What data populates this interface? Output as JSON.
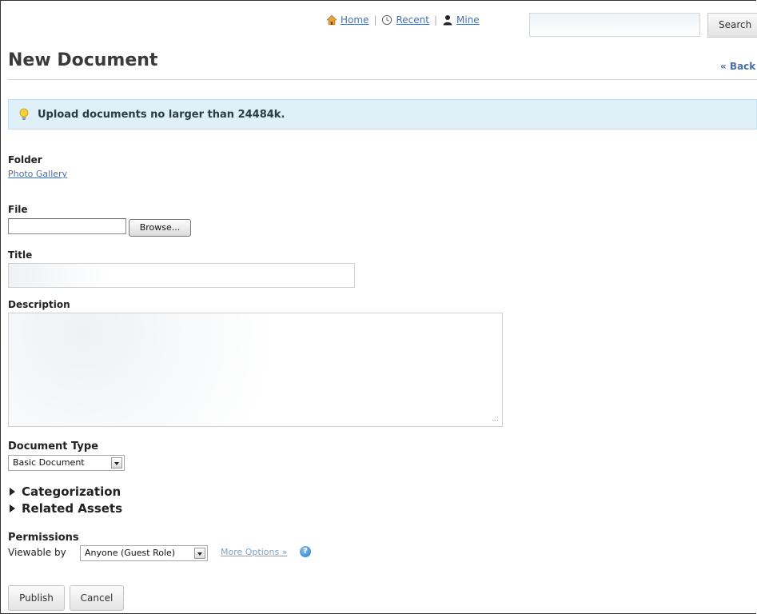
{
  "nav": {
    "home_label": "Home",
    "recent_label": "Recent",
    "mine_label": "Mine",
    "search_value": "",
    "search_button": "Search"
  },
  "page": {
    "title": "New Document",
    "back_label": "« Back"
  },
  "notice": {
    "text": "Upload documents no larger than 24484k."
  },
  "form": {
    "folder_label": "Folder",
    "folder_value": "Photo Gallery",
    "file_label": "File",
    "file_value": "",
    "browse_label": "Browse...",
    "title_label": "Title",
    "title_value": "",
    "description_label": "Description",
    "description_value": "",
    "doctype_label": "Document Type",
    "doctype_value": "Basic Document",
    "categorization_label": "Categorization",
    "related_assets_label": "Related Assets",
    "permissions_label": "Permissions",
    "viewable_by_label": "Viewable by",
    "viewable_by_value": "Anyone (Guest Role)",
    "more_options_label": "More Options »",
    "help_glyph": "?"
  },
  "actions": {
    "publish_label": "Publish",
    "cancel_label": "Cancel"
  },
  "colors": {
    "link": "#4a6fa5",
    "notice_bg": "#dff0f8",
    "accent_help": "#2f76c2"
  },
  "icons": [
    "home-icon",
    "clock-icon",
    "user-icon",
    "lightbulb-icon",
    "help-icon",
    "expand-triangle-icon",
    "dropdown-arrow-icon"
  ]
}
